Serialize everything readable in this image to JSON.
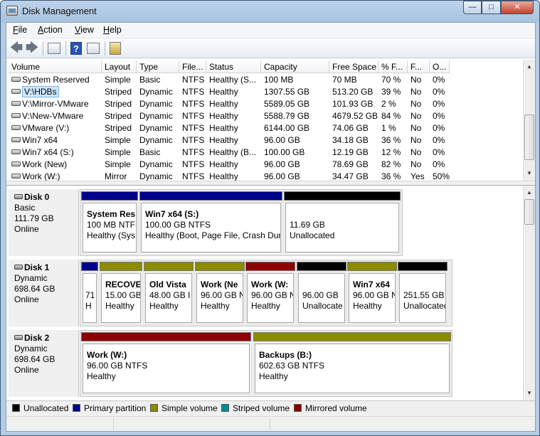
{
  "window": {
    "title": "Disk Management"
  },
  "colors": {
    "unallocated": "#000000",
    "primary": "#00008b",
    "simple": "#8b8b00",
    "striped": "#008b8b",
    "mirrored": "#8b0000"
  },
  "menu": {
    "file": "File",
    "action": "Action",
    "view": "View",
    "help": "Help"
  },
  "toolbar": {
    "icons": [
      "back-arrow-icon",
      "forward-arrow-icon",
      "show-hide-console-tree-icon",
      "help-icon",
      "properties-icon",
      "settings-icon"
    ]
  },
  "volume_list": {
    "columns": [
      "Volume",
      "Layout",
      "Type",
      "File...",
      "Status",
      "Capacity",
      "Free Space",
      "% F...",
      "F...",
      "O..."
    ],
    "rows": [
      [
        "System Reserved",
        "Simple",
        "Basic",
        "NTFS",
        "Healthy (S...",
        "100 MB",
        "70 MB",
        "70 %",
        "No",
        "0%"
      ],
      [
        "V:\\HDBs",
        "Striped",
        "Dynamic",
        "NTFS",
        "Healthy",
        "1307.55 GB",
        "513.20 GB",
        "39 %",
        "No",
        "0%"
      ],
      [
        "V:\\Mirror-VMware",
        "Striped",
        "Dynamic",
        "NTFS",
        "Healthy",
        "5589.05 GB",
        "101.93 GB",
        "2 %",
        "No",
        "0%"
      ],
      [
        "V:\\New-VMware",
        "Striped",
        "Dynamic",
        "NTFS",
        "Healthy",
        "5588.79 GB",
        "4679.52 GB",
        "84 %",
        "No",
        "0%"
      ],
      [
        "VMware (V:)",
        "Striped",
        "Dynamic",
        "NTFS",
        "Healthy",
        "6144.00 GB",
        "74.06 GB",
        "1 %",
        "No",
        "0%"
      ],
      [
        "Win7 x64",
        "Simple",
        "Dynamic",
        "NTFS",
        "Healthy",
        "96.00 GB",
        "34.18 GB",
        "36 %",
        "No",
        "0%"
      ],
      [
        "Win7 x64 (S:)",
        "Simple",
        "Basic",
        "NTFS",
        "Healthy (B...",
        "100.00 GB",
        "12.19 GB",
        "12 %",
        "No",
        "0%"
      ],
      [
        "Work (New)",
        "Simple",
        "Dynamic",
        "NTFS",
        "Healthy",
        "96.00 GB",
        "78.69 GB",
        "82 %",
        "No",
        "0%"
      ],
      [
        "Work (W:)",
        "Mirror",
        "Dynamic",
        "NTFS",
        "Healthy",
        "96.00 GB",
        "34.47 GB",
        "36 %",
        "Yes",
        "50%"
      ]
    ]
  },
  "disks": [
    {
      "name": "Disk 0",
      "type": "Basic",
      "size": "111.79 GB",
      "state": "Online",
      "partitions": [
        {
          "name": "System Res",
          "line1": "100 MB NTF",
          "line2": "Healthy (Sys",
          "kind": "primary"
        },
        {
          "name": "Win7 x64  (S:)",
          "line1": "100.00 GB NTFS",
          "line2": "Healthy (Boot, Page File, Crash Dun",
          "kind": "primary"
        },
        {
          "name": "",
          "line1": "11.69 GB",
          "line2": "Unallocated",
          "kind": "unallocated"
        }
      ]
    },
    {
      "name": "Disk 1",
      "type": "Dynamic",
      "size": "698.64 GB",
      "state": "Online",
      "partitions": [
        {
          "name": "",
          "line1": "71",
          "line2": "H",
          "kind": "primary"
        },
        {
          "name": "RECOVE",
          "line1": "15.00 GB",
          "line2": "Healthy",
          "kind": "simple"
        },
        {
          "name": "Old Vista",
          "line1": "48.00 GB I",
          "line2": "Healthy",
          "kind": "simple"
        },
        {
          "name": "Work (Ne",
          "line1": "96.00 GB N",
          "line2": "Healthy",
          "kind": "simple"
        },
        {
          "name": "Work  (W:",
          "line1": "96.00 GB N",
          "line2": "Healthy",
          "kind": "mirrored"
        },
        {
          "name": "",
          "line1": "96.00 GB",
          "line2": "Unallocate",
          "kind": "unallocated"
        },
        {
          "name": "Win7 x64",
          "line1": "96.00 GB N",
          "line2": "Healthy",
          "kind": "simple"
        },
        {
          "name": "",
          "line1": "251.55 GB",
          "line2": "Unallocated",
          "kind": "unallocated"
        }
      ]
    },
    {
      "name": "Disk 2",
      "type": "Dynamic",
      "size": "698.64 GB",
      "state": "Online",
      "partitions": [
        {
          "name": "Work  (W:)",
          "line1": "96.00 GB NTFS",
          "line2": "Healthy",
          "kind": "mirrored"
        },
        {
          "name": "Backups  (B:)",
          "line1": "602.63 GB NTFS",
          "line2": "Healthy",
          "kind": "simple"
        }
      ]
    }
  ],
  "legend": [
    {
      "label": "Unallocated",
      "kind": "unallocated"
    },
    {
      "label": "Primary partition",
      "kind": "primary"
    },
    {
      "label": "Simple volume",
      "kind": "simple"
    },
    {
      "label": "Striped volume",
      "kind": "striped"
    },
    {
      "label": "Mirrored volume",
      "kind": "mirrored"
    }
  ]
}
